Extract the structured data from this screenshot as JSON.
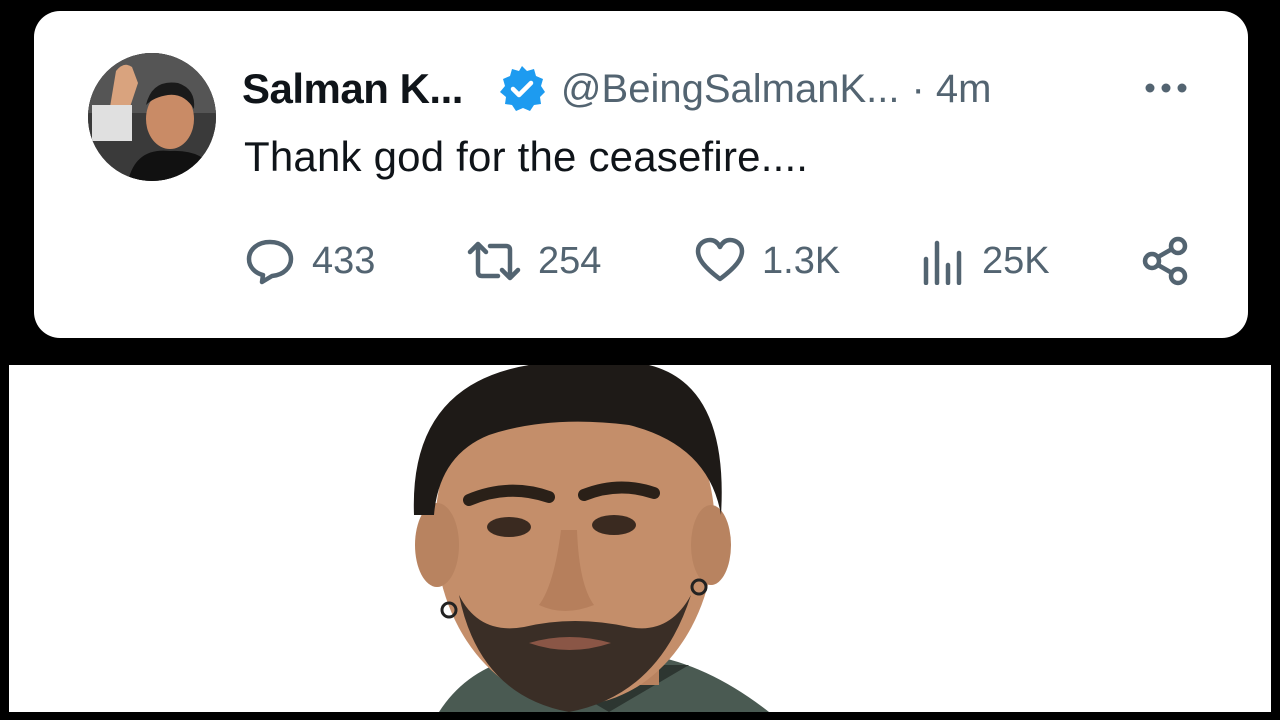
{
  "tweet": {
    "display_name": "Salman K...",
    "handle": "@BeingSalmanK...",
    "time": "· 4m",
    "text": "Thank god for the ceasefire....",
    "verified_color": "#1d9bf0",
    "actions": {
      "replies": "433",
      "reposts": "254",
      "likes": "1.3K",
      "views": "25K"
    },
    "icons": [
      "more-icon",
      "reply-icon",
      "repost-icon",
      "like-icon",
      "views-icon",
      "share-icon"
    ]
  },
  "colors": {
    "text_primary": "#0f1419",
    "text_secondary": "#536471",
    "background": "#000000"
  }
}
